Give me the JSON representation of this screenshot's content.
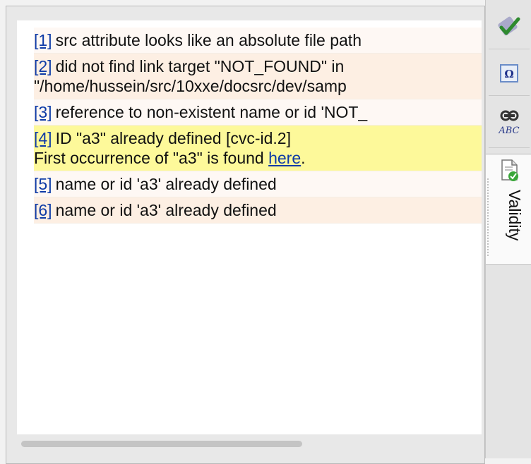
{
  "messages": [
    {
      "num": "[1]",
      "text": "src attribute looks like an absolute file path",
      "text2": ""
    },
    {
      "num": "[2]",
      "text": "did not find link target \"NOT_FOUND\" in",
      "text2": "\"/home/hussein/src/10xxe/docsrc/dev/samp"
    },
    {
      "num": "[3]",
      "text": "reference to non-existent name or id 'NOT_",
      "text2": ""
    },
    {
      "num": "[4]",
      "text": "ID \"a3\" already defined [cvc-id.2]",
      "text2": "First occurrence of \"a3\" is found ",
      "link": "here",
      "after": "."
    },
    {
      "num": "[5]",
      "text": "name or id 'a3' already defined",
      "text2": ""
    },
    {
      "num": "[6]",
      "text": "name or id 'a3' already defined",
      "text2": ""
    }
  ],
  "sidebar": {
    "tools": [
      "spell-check-icon",
      "special-characters-icon",
      "find-abc-icon"
    ],
    "active_tab": {
      "label": "Validity",
      "icon": "validity-document-icon"
    }
  },
  "colors": {
    "row_odd": "#fef8f4",
    "row_even": "#fdefe3",
    "row_selected": "#fdf99a",
    "link": "#0d3aa6"
  }
}
